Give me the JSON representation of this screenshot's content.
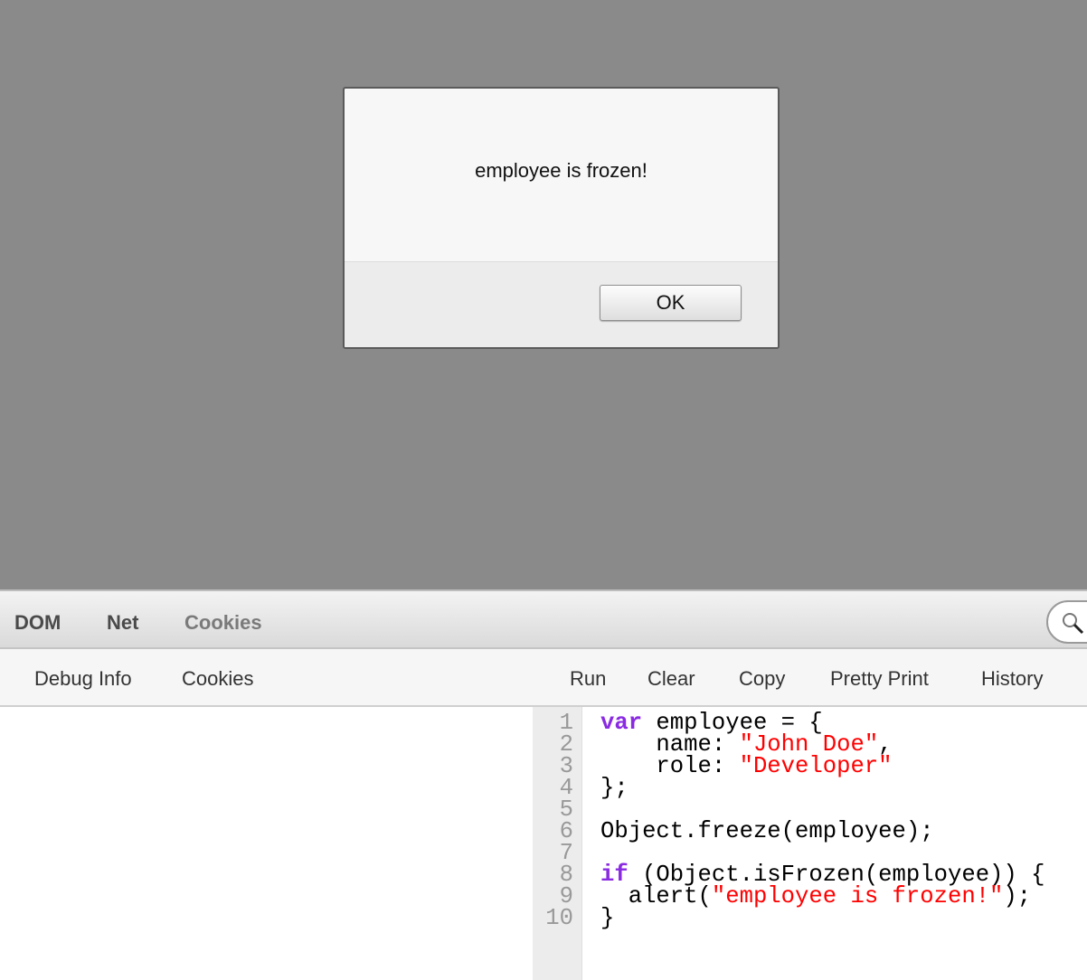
{
  "dialog": {
    "message": "employee is frozen!",
    "ok_label": "OK"
  },
  "devtools": {
    "tabs": [
      {
        "label": "DOM"
      },
      {
        "label": "Net"
      },
      {
        "label": "Cookies"
      }
    ],
    "subtabs": [
      {
        "label": "Debug Info"
      },
      {
        "label": "Cookies"
      }
    ],
    "actions": [
      {
        "label": "Run"
      },
      {
        "label": "Clear"
      },
      {
        "label": "Copy"
      },
      {
        "label": "Pretty Print"
      },
      {
        "label": "History"
      }
    ]
  },
  "editor": {
    "lines": [
      [
        [
          "kw",
          "var"
        ],
        [
          "pl",
          " employee = {"
        ]
      ],
      [
        [
          "pl",
          "    name: "
        ],
        [
          "str",
          "\"John Doe\""
        ],
        [
          "pl",
          ","
        ]
      ],
      [
        [
          "pl",
          "    role: "
        ],
        [
          "str",
          "\"Developer\""
        ]
      ],
      [
        [
          "pl",
          "};"
        ]
      ],
      [],
      [
        [
          "pl",
          "Object.freeze(employee);"
        ]
      ],
      [],
      [
        [
          "kw",
          "if"
        ],
        [
          "pl",
          " (Object.isFrozen(employee)) {"
        ]
      ],
      [
        [
          "pl",
          "  alert("
        ],
        [
          "str",
          "\"employee is frozen!\""
        ],
        [
          "pl",
          ");"
        ]
      ],
      [
        [
          "pl",
          "}"
        ]
      ]
    ]
  },
  "colors": {
    "keyword": "#8a2be2",
    "string": "#ff0000"
  }
}
